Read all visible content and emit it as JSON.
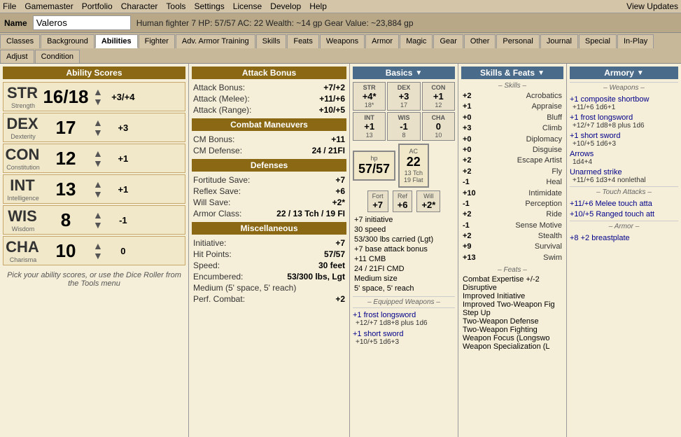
{
  "menubar": {
    "items": [
      "File",
      "Gamemaster",
      "Portfolio",
      "Character",
      "Tools",
      "Settings",
      "License",
      "Develop",
      "Help"
    ],
    "view_updates": "View Updates"
  },
  "namebar": {
    "name_label": "Name",
    "name_value": "Valeros",
    "char_info": "Human fighter 7   HP: 57/57   AC: 22   Wealth: ~14 gp   Gear Value: ~23,884 gp"
  },
  "tabs": {
    "items": [
      "Classes",
      "Background",
      "Abilities",
      "Fighter",
      "Adv. Armor Training",
      "Skills",
      "Feats",
      "Weapons",
      "Armor",
      "Magic",
      "Gear",
      "Other",
      "Personal",
      "Journal",
      "Special",
      "In-Play",
      "Adjust",
      "Condition"
    ],
    "active": "Abilities"
  },
  "ability_scores": {
    "header": "Ability Scores",
    "abilities": [
      {
        "abbr": "STR",
        "name": "Strength",
        "score": "16/18",
        "mod": "+3/+4"
      },
      {
        "abbr": "DEX",
        "name": "Dexterity",
        "score": "17",
        "mod": "+3"
      },
      {
        "abbr": "CON",
        "name": "Constitution",
        "score": "12",
        "mod": "+1"
      },
      {
        "abbr": "INT",
        "name": "Intelligence",
        "score": "13",
        "mod": "+1"
      },
      {
        "abbr": "WIS",
        "name": "Wisdom",
        "score": "8",
        "mod": "-1"
      },
      {
        "abbr": "CHA",
        "name": "Charisma",
        "score": "10",
        "mod": "0"
      }
    ],
    "info_text": "Pick your ability scores, or use the Dice Roller from the Tools menu"
  },
  "attack_bonus": {
    "header": "Attack Bonus",
    "rows": [
      {
        "label": "Attack Bonus:",
        "value": "+7/+2"
      },
      {
        "label": "Attack (Melee):",
        "value": "+11/+6"
      },
      {
        "label": "Attack (Range):",
        "value": "+10/+5"
      }
    ]
  },
  "combat_maneuvers": {
    "header": "Combat Maneuvers",
    "rows": [
      {
        "label": "CM Bonus:",
        "value": "+11"
      },
      {
        "label": "CM Defense:",
        "value": "24 / 21FI"
      }
    ]
  },
  "defenses": {
    "header": "Defenses",
    "rows": [
      {
        "label": "Fortitude Save:",
        "value": "+7"
      },
      {
        "label": "Reflex Save:",
        "value": "+6"
      },
      {
        "label": "Will Save:",
        "value": "+2*"
      },
      {
        "label": "Armor Class:",
        "value": "22 / 13 Tch / 19 FI"
      }
    ]
  },
  "miscellaneous": {
    "header": "Miscellaneous",
    "rows": [
      {
        "label": "Initiative:",
        "value": "+7"
      },
      {
        "label": "Hit Points:",
        "value": "57/57"
      },
      {
        "label": "Speed:",
        "value": "30 feet"
      },
      {
        "label": "Encumbered:",
        "value": "53/300 lbs, Lgt"
      },
      {
        "label": "Medium (5' space, 5' reach)",
        "value": ""
      },
      {
        "label": "Perf. Combat:",
        "value": "+2"
      }
    ]
  },
  "basics": {
    "header": "Basics",
    "mini_stats": [
      {
        "abbr": "STR",
        "val": "+4*",
        "sub": "18*"
      },
      {
        "abbr": "DEX",
        "val": "+3",
        "sub": "17"
      },
      {
        "abbr": "CON",
        "val": "+1",
        "sub": "12"
      },
      {
        "abbr": "INT",
        "val": "+1",
        "sub": "13"
      },
      {
        "abbr": "WIS",
        "val": "-1",
        "sub": "8"
      },
      {
        "abbr": "CHA",
        "val": "0",
        "sub": "10"
      }
    ],
    "hp": {
      "current": "57/57",
      "label": "hp",
      "sub": ""
    },
    "ac": {
      "val": "22",
      "label": "AC",
      "sub": "13 Tch\n19 Flat"
    },
    "saves": [
      {
        "label": "Fort",
        "val": "+7"
      },
      {
        "label": "Ref",
        "val": "+6"
      },
      {
        "label": "Will",
        "val": "+2*"
      }
    ],
    "misc_info": [
      "+7 initiative",
      "30 speed",
      "53/300 lbs carried (Lgt)",
      "+7 base attack bonus",
      "+11  CMB",
      "24 / 21FI  CMD",
      "Medium size",
      "5' space, 5' reach"
    ],
    "equipped_header": "– Equipped Weapons –",
    "equipped_weapons": [
      {
        "name": "+1 frost longsword",
        "stats": "+12/+7  1d8+8 plus 1d6"
      },
      {
        "name": "+1 short sword",
        "stats": "+10/+5  1d6+3"
      }
    ]
  },
  "skills_feats": {
    "header": "Skills & Feats",
    "skills_header": "– Skills –",
    "skills": [
      {
        "val": "+2",
        "name": "Acrobatics"
      },
      {
        "val": "+1",
        "name": "Appraise"
      },
      {
        "val": "+0",
        "name": "Bluff"
      },
      {
        "val": "+3",
        "name": "Climb"
      },
      {
        "val": "+0",
        "name": "Diplomacy"
      },
      {
        "val": "+0",
        "name": "Disguise"
      },
      {
        "val": "+2",
        "name": "Escape Artist"
      },
      {
        "val": "+2",
        "name": "Fly"
      },
      {
        "val": "-1",
        "name": "Heal"
      },
      {
        "val": "+10",
        "name": "Intimidate"
      },
      {
        "val": "-1",
        "name": "Perception"
      },
      {
        "val": "+2",
        "name": "Ride"
      },
      {
        "val": "-1",
        "name": "Sense Motive"
      },
      {
        "val": "+2",
        "name": "Stealth"
      },
      {
        "val": "+9",
        "name": "Survival"
      },
      {
        "val": "+13",
        "name": "Swim"
      }
    ],
    "feats_header": "– Feats –",
    "feats": [
      "Combat Expertise +/-2",
      "Disruptive",
      "Improved Initiative",
      "Improved Two-Weapon Fig",
      "Step Up",
      "Two-Weapon Defense",
      "Two-Weapon Fighting",
      "Weapon Focus (Longswo",
      "Weapon Specialization (L"
    ]
  },
  "armory": {
    "header": "Armory",
    "weapons_header": "– Weapons –",
    "weapons": [
      {
        "name": "+1 composite shortbow",
        "stats": "+11/+6  1d6+1"
      },
      {
        "name": "+1 frost longsword",
        "stats": "+12/+7  1d8+8 plus 1d6"
      },
      {
        "name": "+1 short sword",
        "stats": "+10/+5  1d6+3"
      },
      {
        "name": "Arrows",
        "stats": "1d4+4"
      },
      {
        "name": "Unarmed strike",
        "stats": "+11/+6  1d3+4 nonlethal"
      }
    ],
    "touch_header": "– Touch Attacks –",
    "touch": [
      {
        "name": "Melee touch atta",
        "stats": "+11/+6"
      },
      {
        "name": "Ranged touch att",
        "stats": "+10/+5"
      }
    ],
    "armor_header": "– Armor –",
    "armor": [
      {
        "name": "+8 +2 breastplate",
        "stats": ""
      }
    ]
  }
}
